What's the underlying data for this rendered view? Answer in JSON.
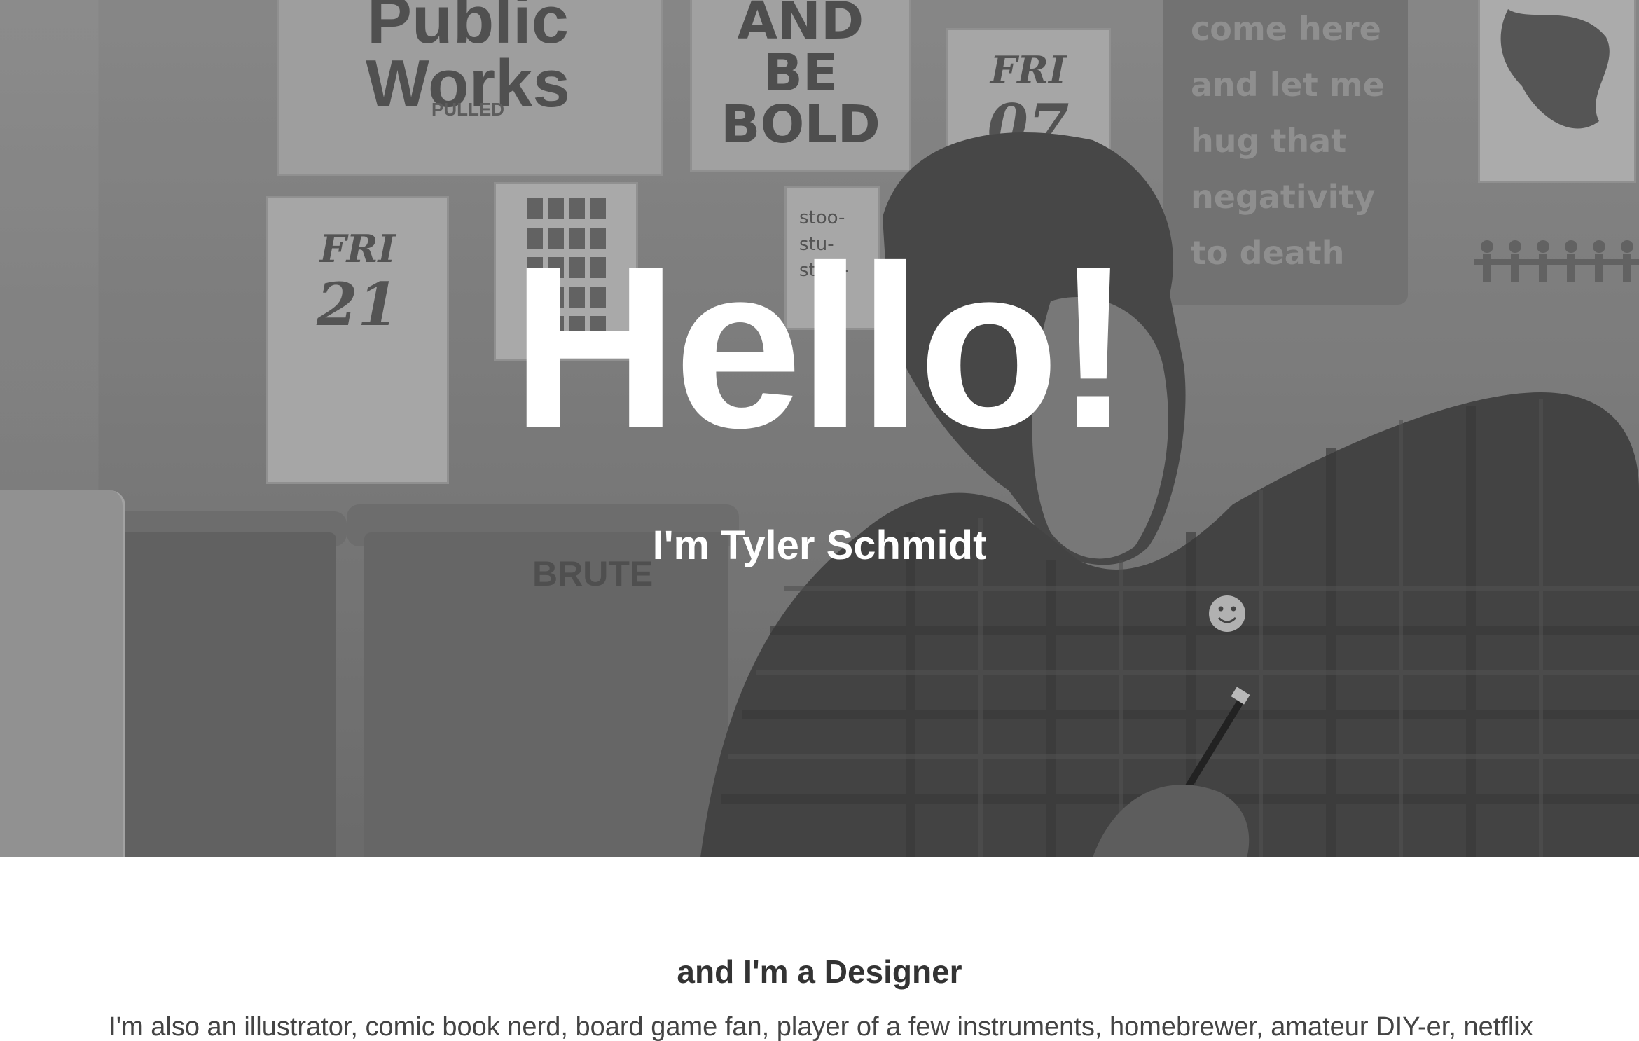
{
  "hero": {
    "title": "Hello!",
    "subtitle": "I'm Tyler Schmidt",
    "background": {
      "posters": {
        "public_works": "Public Works",
        "public_works_small": "PULLED",
        "be_bold": "AND BE BOLD",
        "fri_07_day": "FRI",
        "fri_07_date": "07",
        "fri_21_day": "FRI",
        "fri_21_date": "21",
        "stool": "stoo- stu- stew-",
        "hug_lines": [
          "come here",
          "and let me",
          "hug that",
          "negativity",
          "to death"
        ],
        "bin_label": "BRUTE"
      }
    }
  },
  "content": {
    "heading": "and I'm a Designer",
    "body": "I'm also an illustrator, comic book nerd, board game fan, player of a few instruments, homebrewer, amateur DIY-er, netflix"
  },
  "colors": {
    "hero_text": "#ffffff",
    "heading_text": "#333333",
    "body_text": "#444444",
    "page_bg": "#ffffff"
  }
}
